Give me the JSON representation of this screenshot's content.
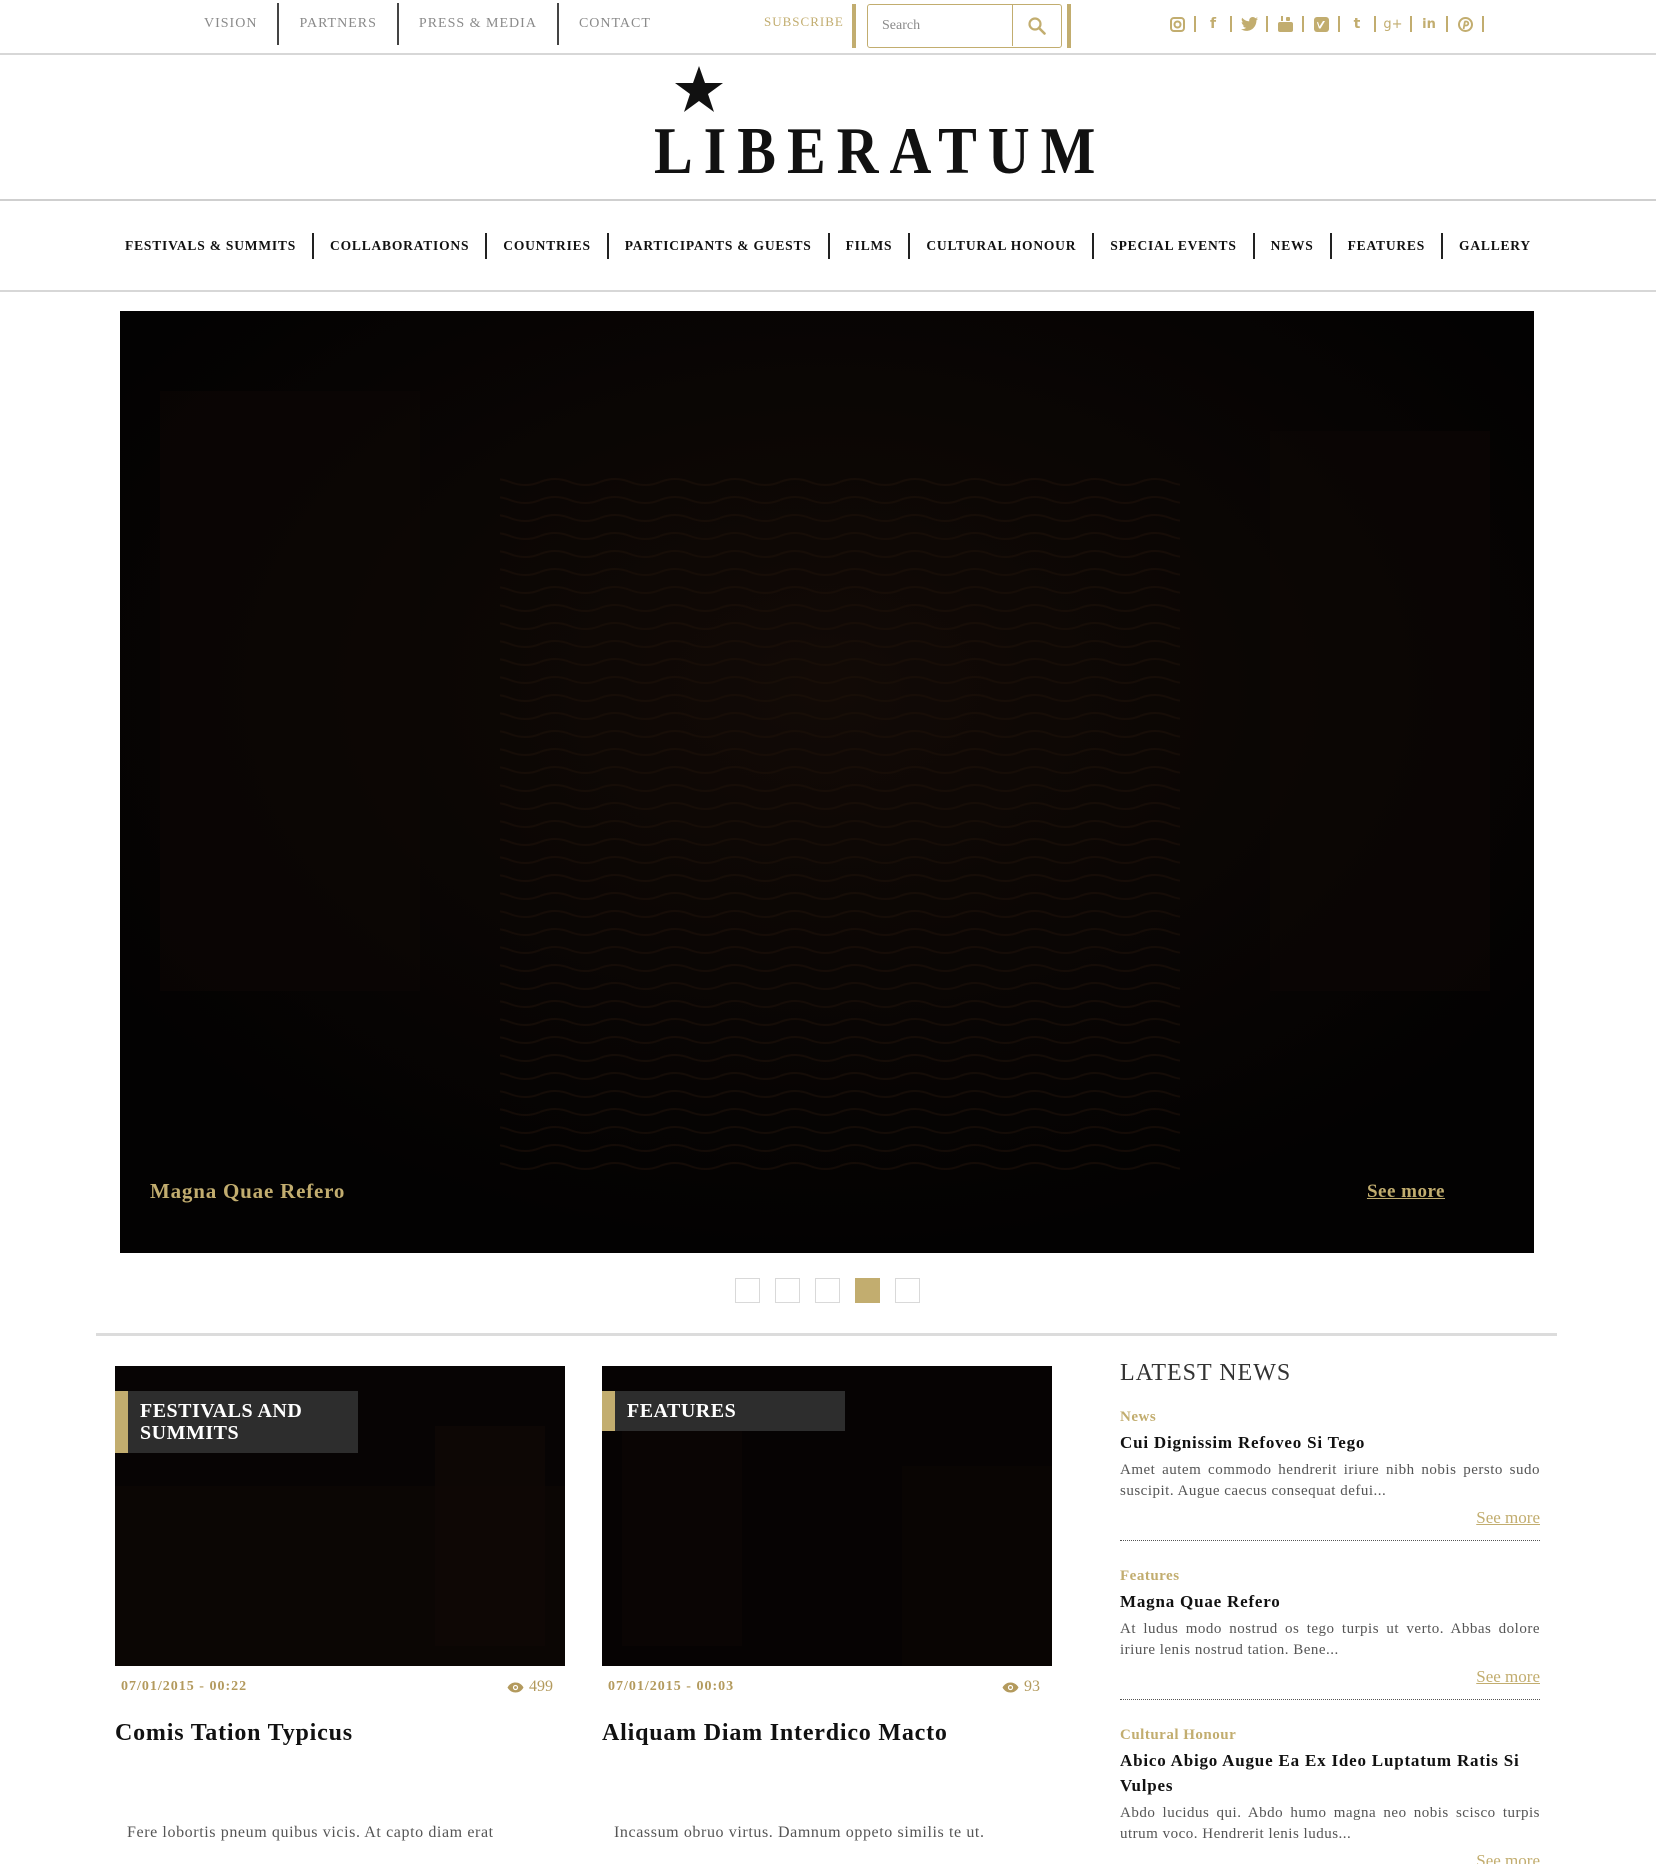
{
  "topbar": {
    "links": [
      "VISION",
      "PARTNERS",
      "PRESS & MEDIA",
      "CONTACT"
    ],
    "subscribe_label": "SUBSCRIBE",
    "search_placeholder": "Search",
    "socials": [
      "instagram-icon",
      "facebook-icon",
      "twitter-icon",
      "youtube-icon",
      "vimeo-icon",
      "tumblr-icon",
      "google-plus-icon",
      "linkedin-icon",
      "pinterest-icon"
    ]
  },
  "logo": {
    "text": "LIBERATUM"
  },
  "nav": {
    "items": [
      "FESTIVALS & SUMMITS",
      "COLLABORATIONS",
      "COUNTRIES",
      "PARTICIPANTS & GUESTS",
      "FILMS",
      "CULTURAL HONOUR",
      "SPECIAL EVENTS",
      "NEWS",
      "FEATURES",
      "GALLERY"
    ]
  },
  "hero": {
    "caption": "Magna Quae Refero",
    "see_more": "See more",
    "active_slide": 4,
    "slide_count": 5
  },
  "cards": [
    {
      "tag": "FESTIVALS AND SUMMITS",
      "date": "07/01/2015 - 00:22",
      "views": "499",
      "title": "Comis Tation Typicus",
      "body": "Fere lobortis pneum quibus vicis. At capto diam erat"
    },
    {
      "tag": "FEATURES",
      "date": "07/01/2015 - 00:03",
      "views": "93",
      "title": "Aliquam Diam Interdico Macto",
      "body": "Incassum obruo virtus. Damnum oppeto similis te ut."
    }
  ],
  "latest_news": {
    "heading": "LATEST NEWS",
    "items": [
      {
        "category": "News",
        "title": "Cui Dignissim Refoveo Si Tego",
        "excerpt": "Amet autem commodo hendrerit iriure nibh nobis persto sudo suscipit. Augue caecus consequat defui...",
        "more": "See more"
      },
      {
        "category": "Features",
        "title": "Magna Quae Refero",
        "excerpt": "At ludus modo nostrud os tego turpis ut verto. Abbas dolore iriure lenis nostrud tation. Bene...",
        "more": "See more"
      },
      {
        "category": "Cultural Honour",
        "title": "Abico Abigo Augue Ea Ex Ideo Luptatum Ratis Si Vulpes",
        "excerpt": "Abdo lucidus qui. Abdo humo magna neo nobis scisco turpis utrum voco. Hendrerit lenis ludus...",
        "more": "See more"
      }
    ]
  },
  "colors": {
    "gold": "#c2ad6f",
    "dark": "#2d2d2d",
    "hero_bg": "#050303"
  }
}
